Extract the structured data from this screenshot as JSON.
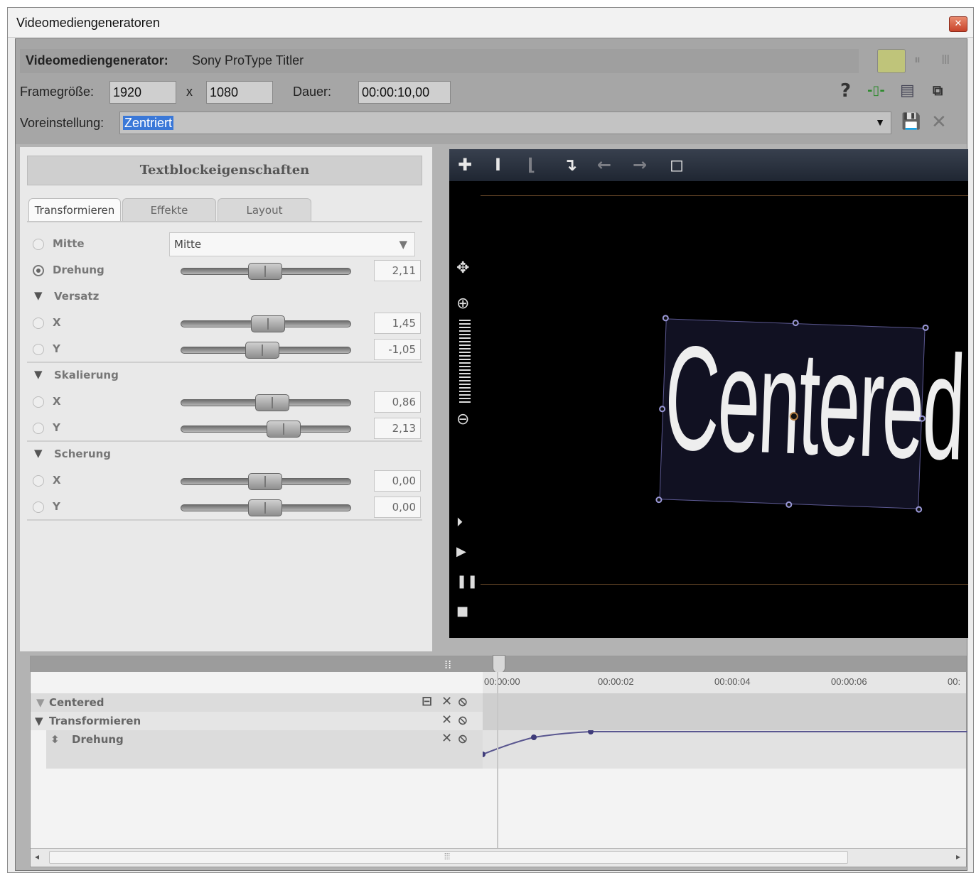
{
  "window": {
    "title": "Videomediengeneratoren"
  },
  "generator": {
    "label": "Videomediengenerator:",
    "name": "Sony ProType Titler",
    "frame_label": "Framegröße:",
    "width": "1920",
    "x_sep": "x",
    "height": "1080",
    "duration_label": "Dauer:",
    "duration": "00:00:10,00",
    "preset_label": "Voreinstellung:",
    "preset": "Zentriert"
  },
  "props": {
    "header": "Textblockeigenschaften",
    "tabs": [
      "Transformieren",
      "Effekte",
      "Layout"
    ],
    "mitte_label": "Mitte",
    "mitte_value": "Mitte",
    "drehung_label": "Drehung",
    "drehung_value": "2,11",
    "versatz_label": "Versatz",
    "versatz_x_label": "X",
    "versatz_x_value": "1,45",
    "versatz_y_label": "Y",
    "versatz_y_value": "-1,05",
    "skalierung_label": "Skalierung",
    "skal_x_label": "X",
    "skal_x_value": "0,86",
    "skal_y_label": "Y",
    "skal_y_value": "2,13",
    "scherung_label": "Scherung",
    "scher_x_label": "X",
    "scher_x_value": "0,00",
    "scher_y_label": "Y",
    "scher_y_value": "0,00"
  },
  "preview": {
    "text": "Centered"
  },
  "timeline": {
    "ticks": [
      "00:00:00",
      "00:00:02",
      "00:00:04",
      "00:00:06",
      "00:"
    ],
    "rows": [
      "Centered",
      "Transformieren",
      "Drehung"
    ]
  }
}
